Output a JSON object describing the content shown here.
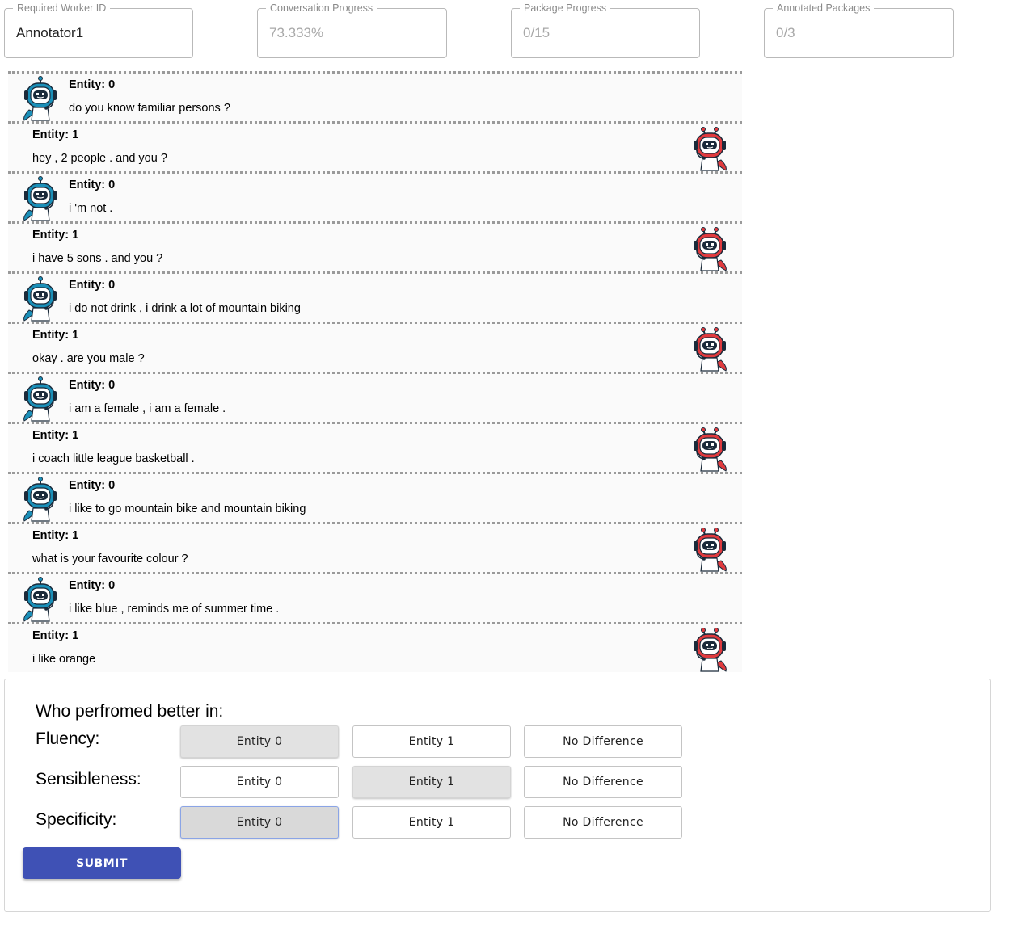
{
  "header": {
    "worker_id": {
      "label": "Required Worker ID",
      "value": "Annotator1"
    },
    "conversation_progress": {
      "label": "Conversation Progress",
      "value": "73.333%"
    },
    "package_progress": {
      "label": "Package Progress",
      "value": "0/15"
    },
    "annotated_packages": {
      "label": "Annotated Packages",
      "value": "0/3"
    }
  },
  "conversation": [
    {
      "entity": "Entity: 0",
      "text": "do you know familiar persons ?"
    },
    {
      "entity": "Entity: 1",
      "text": "hey , 2 people . and you ?"
    },
    {
      "entity": "Entity: 0",
      "text": "i 'm not ."
    },
    {
      "entity": "Entity: 1",
      "text": "i have 5 sons . and you ?"
    },
    {
      "entity": "Entity: 0",
      "text": "i do not drink , i drink a lot of mountain biking"
    },
    {
      "entity": "Entity: 1",
      "text": "okay . are you male ?"
    },
    {
      "entity": "Entity: 0",
      "text": "i am a female , i am a female ."
    },
    {
      "entity": "Entity: 1",
      "text": "i coach little league basketball ."
    },
    {
      "entity": "Entity: 0",
      "text": "i like to go mountain bike and mountain biking"
    },
    {
      "entity": "Entity: 1",
      "text": "what is your favourite colour ?"
    },
    {
      "entity": "Entity: 0",
      "text": "i like blue , reminds me of summer time ."
    },
    {
      "entity": "Entity: 1",
      "text": "i like orange"
    }
  ],
  "avatars": {
    "entity0_icon": "blue-robot-icon",
    "entity1_icon": "red-robot-icon",
    "entity0_color": "#1a8fb8",
    "entity1_color": "#e03a3e"
  },
  "rating": {
    "question": "Who perfromed better in:",
    "criteria": [
      {
        "label": "Fluency:",
        "options": [
          "Entity 0",
          "Entity 1",
          "No Difference"
        ],
        "selected": "Entity 0"
      },
      {
        "label": "Sensibleness:",
        "options": [
          "Entity 0",
          "Entity 1",
          "No Difference"
        ],
        "selected": "Entity 1"
      },
      {
        "label": "Specificity:",
        "options": [
          "Entity 0",
          "Entity 1",
          "No Difference"
        ],
        "selected": "Entity 0"
      }
    ],
    "submit_label": "SUBMIT",
    "submit_color": "#3f51b5"
  }
}
